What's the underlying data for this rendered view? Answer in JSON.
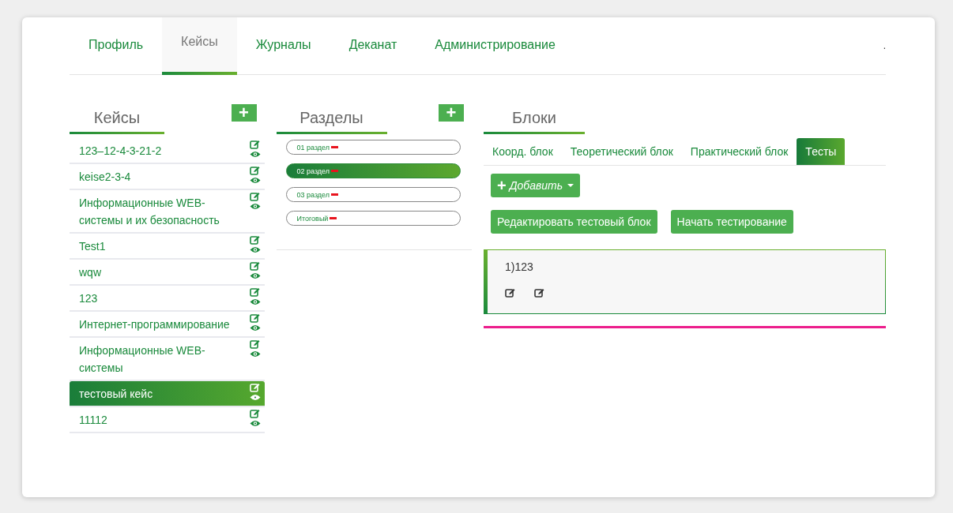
{
  "nav": {
    "tabs": [
      {
        "label": "Профиль",
        "selected": false
      },
      {
        "label": "Кейсы",
        "selected": true
      },
      {
        "label": "Журналы",
        "selected": false
      },
      {
        "label": "Деканат",
        "selected": false
      },
      {
        "label": "Администрирование",
        "selected": false
      }
    ],
    "trailing": "."
  },
  "cases": {
    "title": "Кейсы",
    "add_label": "+",
    "items": [
      {
        "label": "123–12-4-3-21-2",
        "selected": false
      },
      {
        "label": "keise2-3-4",
        "selected": false
      },
      {
        "label": "Информационные WEB-системы и их безопасность",
        "selected": false
      },
      {
        "label": "Test1",
        "selected": false
      },
      {
        "label": "wqw",
        "selected": false
      },
      {
        "label": "123",
        "selected": false
      },
      {
        "label": "Интернет-программирование",
        "selected": false
      },
      {
        "label": "Информационные WEB-системы",
        "selected": false
      },
      {
        "label": "тестовый кейс",
        "selected": true
      },
      {
        "label": "11112",
        "selected": false
      }
    ]
  },
  "sections": {
    "title": "Разделы",
    "add_label": "+",
    "items": [
      {
        "label": "01 раздел",
        "selected": false
      },
      {
        "label": "02 раздел",
        "selected": true
      },
      {
        "label": "03 раздел",
        "selected": false
      },
      {
        "label": "Итоговый",
        "selected": false
      }
    ]
  },
  "blocks": {
    "title": "Блоки",
    "tabs": [
      {
        "label": "Коорд. блок",
        "selected": false
      },
      {
        "label": "Теоретический блок",
        "selected": false
      },
      {
        "label": "Практический блок",
        "selected": false
      },
      {
        "label": "Тесты",
        "selected": true
      }
    ],
    "add_button": "Добавить",
    "add_icon": "+",
    "buttons": [
      "Редактировать тестовый блок",
      "Начать тестирование"
    ],
    "tests": [
      {
        "label": "1)123"
      }
    ]
  }
}
